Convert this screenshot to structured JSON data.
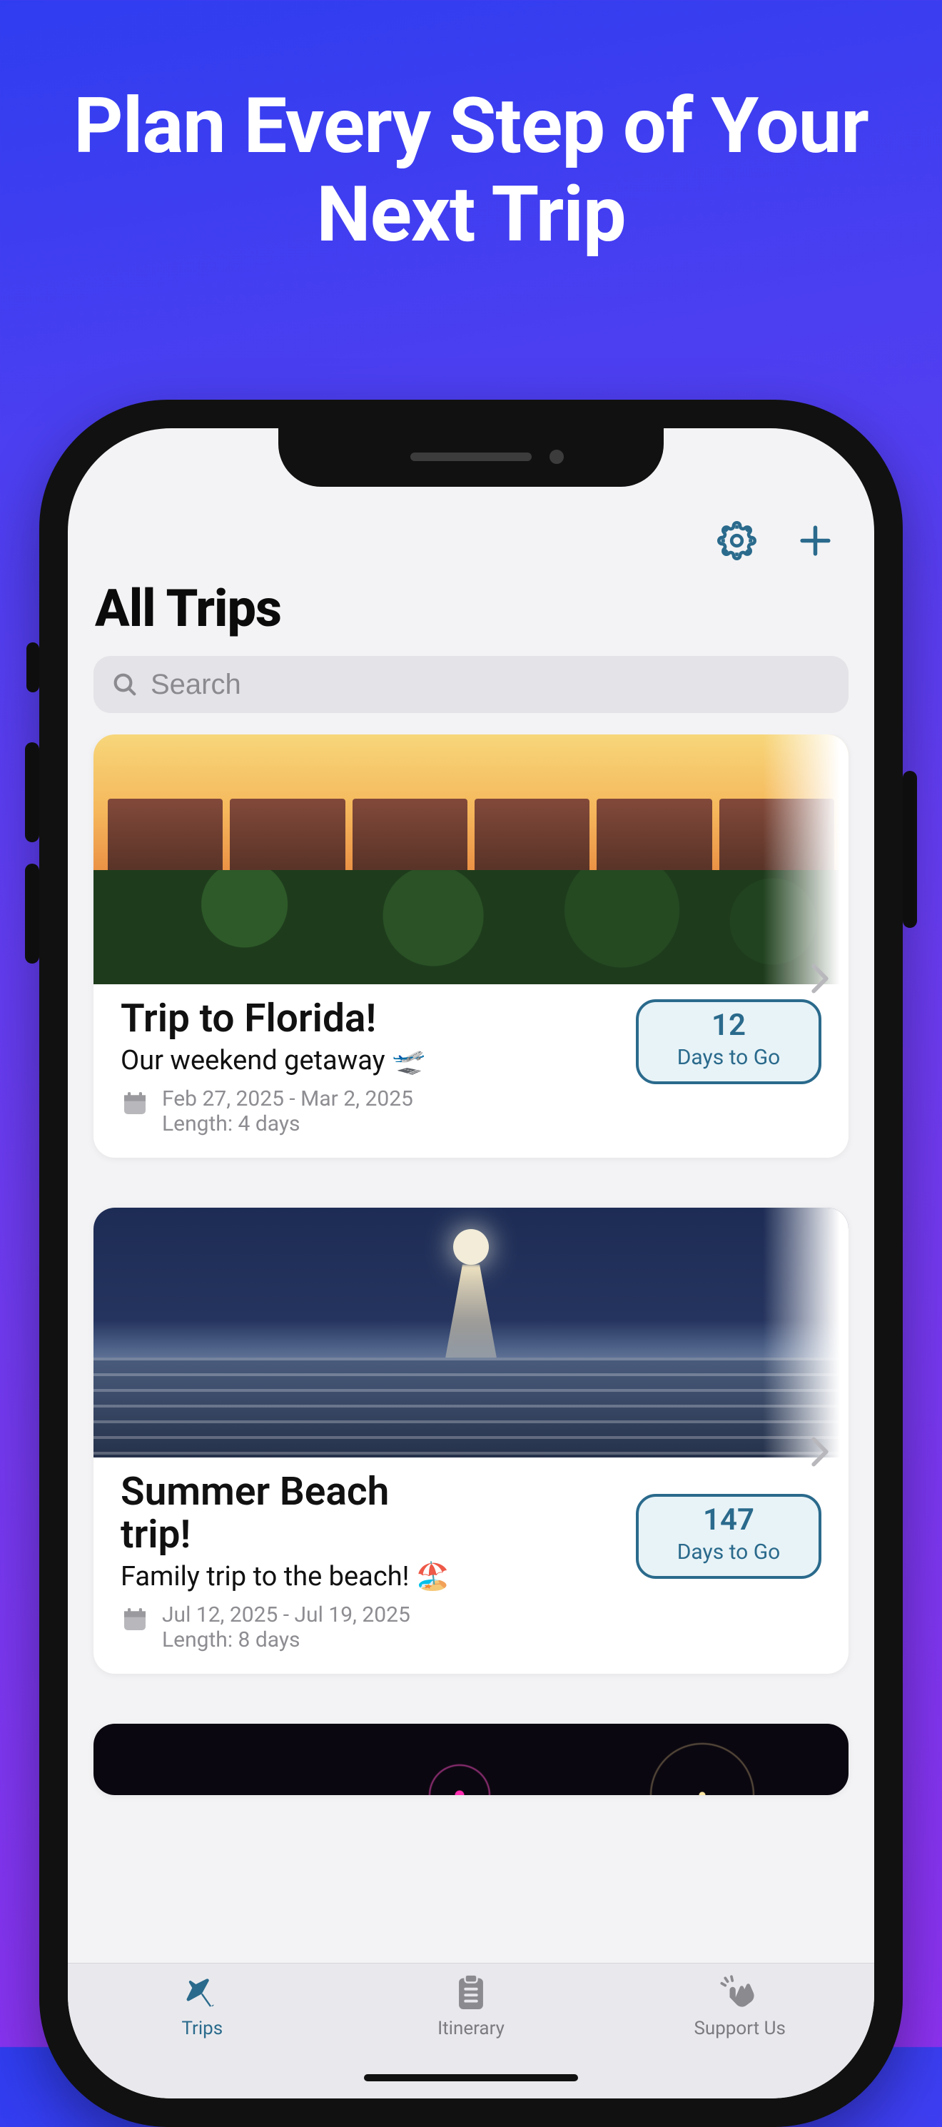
{
  "promo": {
    "headline": "Plan Every Step of Your Next Trip"
  },
  "header": {
    "title": "All Trips"
  },
  "search": {
    "placeholder": "Search"
  },
  "badge_label": "Days to Go",
  "trips": [
    {
      "title": "Trip to Florida!",
      "subtitle": "Our weekend getaway 🛫",
      "dates": "Feb 27, 2025 - Mar 2, 2025",
      "length": "Length: 4 days",
      "countdown": "12"
    },
    {
      "title": "Summer Beach trip!",
      "subtitle": "Family trip to the beach! 🏖️",
      "dates": "Jul 12, 2025 - Jul 19, 2025",
      "length": "Length: 8 days",
      "countdown": "147"
    }
  ],
  "tabs": {
    "trips": "Trips",
    "itinerary": "Itinerary",
    "support": "Support Us"
  },
  "colors": {
    "accent": "#2a6a8c"
  }
}
